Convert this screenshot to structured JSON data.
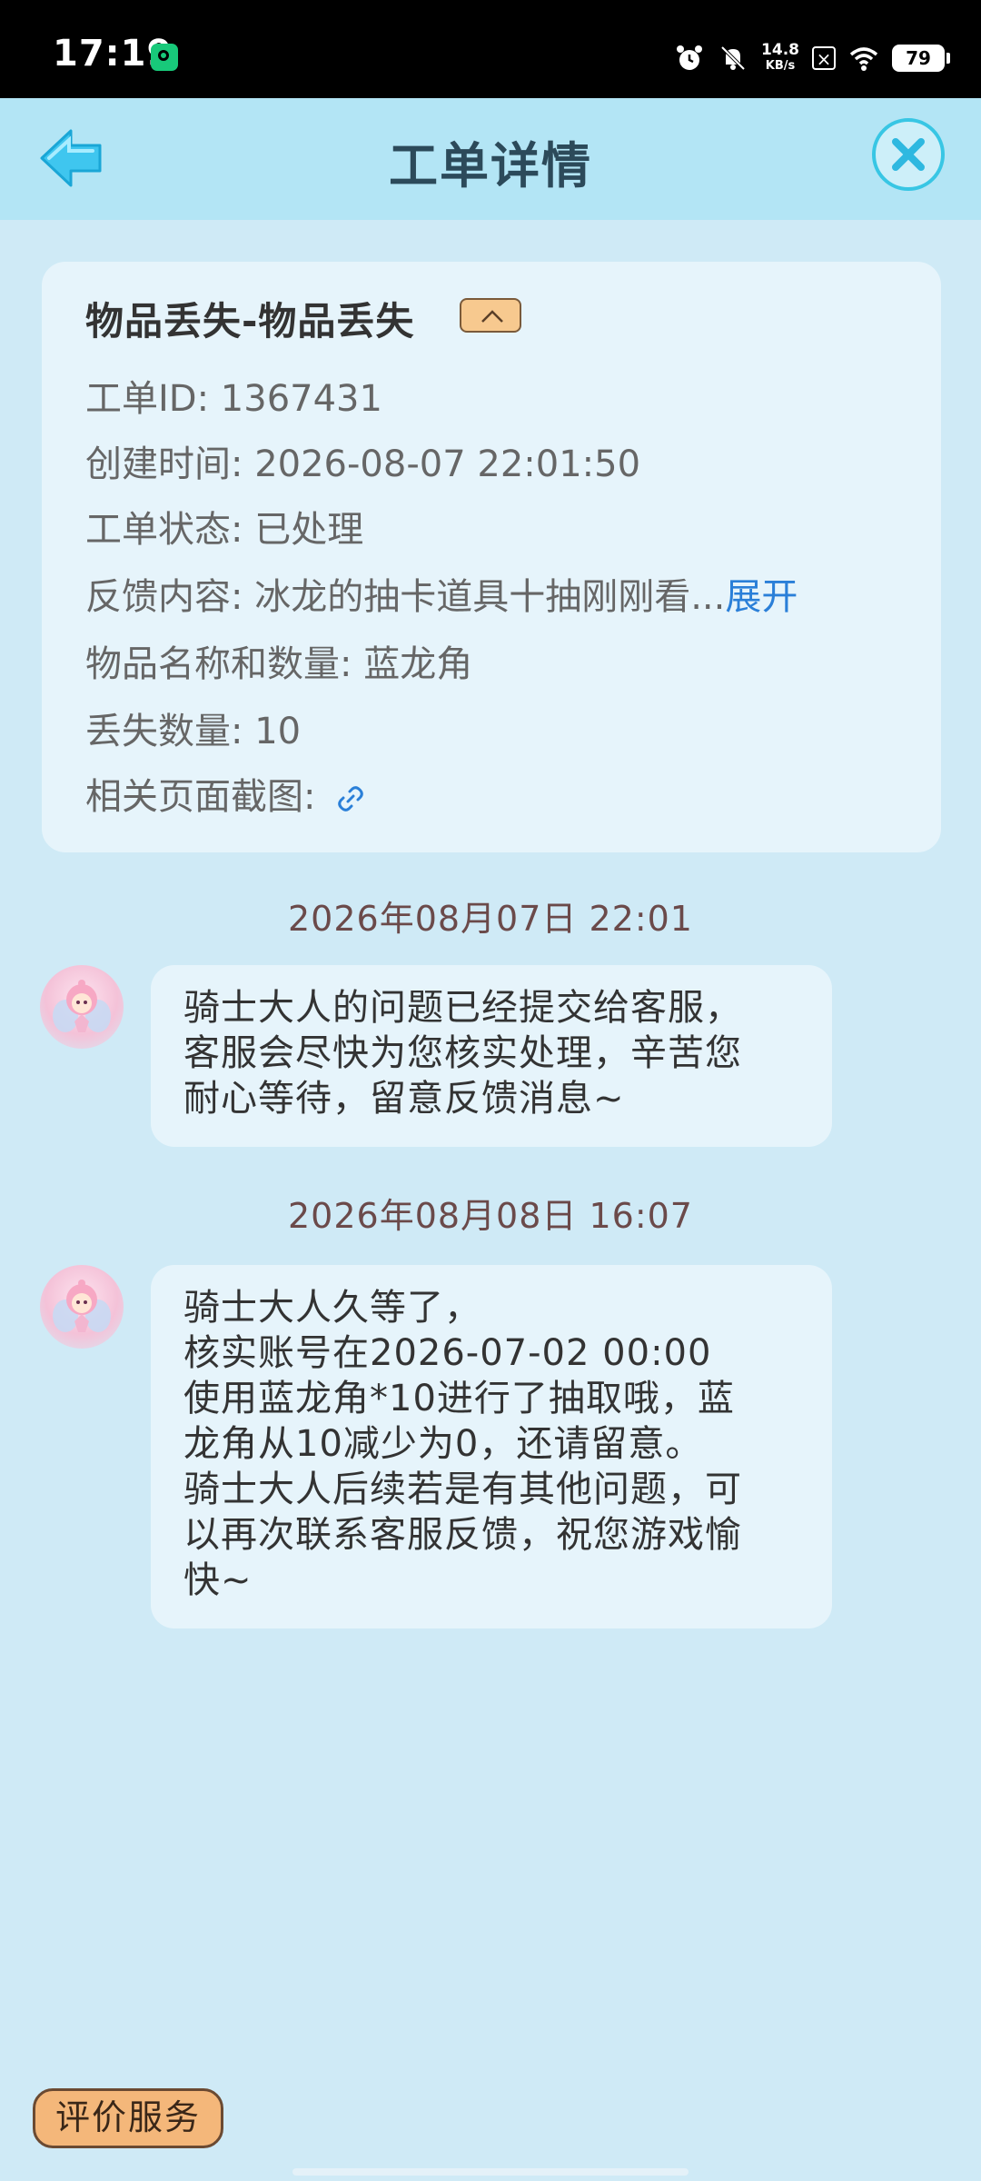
{
  "status_bar": {
    "time": "17:19",
    "net_speed_value": "14.8",
    "net_speed_unit": "KB/s",
    "battery": "79",
    "icons": [
      "app-icon",
      "alarm-icon",
      "mute-icon",
      "x-icon",
      "wifi-icon",
      "battery-icon"
    ]
  },
  "header": {
    "title": "工单详情",
    "back_icon": "arrow-left-icon",
    "close_icon": "close-icon"
  },
  "ticket": {
    "title": "物品丢失-物品丢失",
    "fields": [
      {
        "label": "工单ID: ",
        "value": "1367431"
      },
      {
        "label": "创建时间: ",
        "value": "2026-08-07 22:01:50"
      },
      {
        "label": "工单状态: ",
        "value": "已处理"
      },
      {
        "label": "反馈内容: ",
        "value": "冰龙的抽卡道具十抽刚刚看...",
        "link": "展开"
      },
      {
        "label": "物品名称和数量: ",
        "value": "蓝龙角"
      },
      {
        "label": "丢失数量: ",
        "value": "10"
      },
      {
        "label": "相关页面截图: ",
        "value": ""
      }
    ]
  },
  "messages": [
    {
      "time": "2026年08月07日 22:01",
      "text": "骑士大人的问题已经提交给客服，\n客服会尽快为您核实处理，辛苦您\n耐心等待，留意反馈消息~"
    },
    {
      "time": "2026年08月08日 16:07",
      "text": "骑士大人久等了，\n核实账号在2026-07-02 00:00\n使用蓝龙角*10进行了抽取哦，蓝\n龙角从10减少为0，还请留意。\n骑士大人后续若是有其他问题，可\n以再次联系客服反馈，祝您游戏愉\n快~"
    }
  ],
  "footer": {
    "rate_button": "评价服务"
  },
  "colors": {
    "background": "#cfeaf6",
    "header": "#b3e5f5",
    "card": "#e6f4fb",
    "accent_blue": "#2a7fd8",
    "rate_button": "#f4b77a"
  }
}
